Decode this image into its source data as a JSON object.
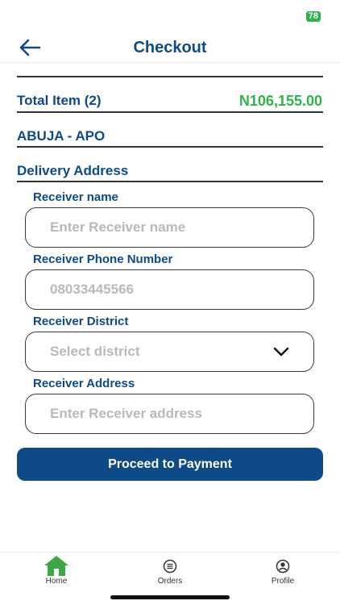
{
  "status_bar": {
    "battery": "78"
  },
  "header": {
    "title": "Checkout"
  },
  "summary": {
    "total_label": "Total Item (2)",
    "total_amount": "N106,155.00",
    "location": "ABUJA - APO",
    "section_title": "Delivery Address"
  },
  "form": {
    "receiver_name": {
      "label": "Receiver name",
      "placeholder": "Enter Receiver name",
      "value": ""
    },
    "receiver_phone": {
      "label": "Receiver Phone Number",
      "placeholder": "08033445566",
      "value": ""
    },
    "receiver_district": {
      "label": "Receiver District",
      "selected": "Select district"
    },
    "receiver_address": {
      "label": "Receiver Address",
      "placeholder": "Enter Receiver address",
      "value": ""
    }
  },
  "actions": {
    "proceed_label": "Proceed to Payment"
  },
  "bottom_nav": {
    "items": [
      {
        "label": "Home",
        "icon": "home-icon",
        "active": true
      },
      {
        "label": "Orders",
        "icon": "orders-icon",
        "active": false
      },
      {
        "label": "Profile",
        "icon": "profile-icon",
        "active": false
      }
    ]
  },
  "colors": {
    "primary": "#0e4a86",
    "accent_green": "#2fb34a",
    "placeholder": "#b9b9b9"
  }
}
